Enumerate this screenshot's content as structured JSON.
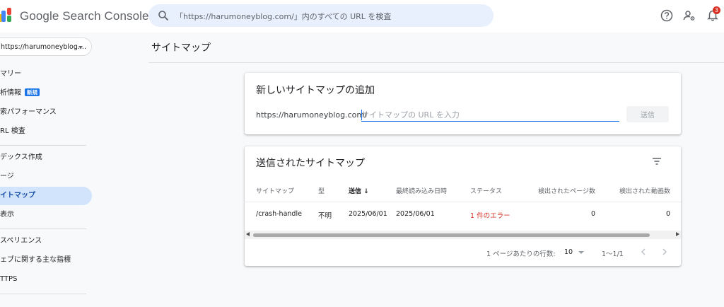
{
  "header": {
    "app_title": "Google Search Console",
    "search_placeholder": "「https://harumoneyblog.com/」内のすべての URL を検査",
    "notification_count": "3",
    "icons": [
      "logo-icon",
      "search-icon",
      "help-icon",
      "manage-users-icon",
      "notifications-icon"
    ]
  },
  "sidebar": {
    "property": "https://harumoneyblog....",
    "items": [
      {
        "label": "マリー"
      },
      {
        "label": "析情報",
        "badge": "新規"
      },
      {
        "label": "索パフォーマンス"
      },
      {
        "label": "RL 検査"
      },
      {
        "label": "デックス作成"
      },
      {
        "label": "ージ"
      },
      {
        "label": "イトマップ",
        "active": true
      },
      {
        "label": "表示"
      },
      {
        "label": "スペリエンス"
      },
      {
        "label": "ェブに関する主な指標"
      },
      {
        "label": "TTPS"
      }
    ]
  },
  "main": {
    "page_title": "サイトマップ",
    "add_card": {
      "title": "新しいサイトマップの追加",
      "url_prefix": "https://harumoneyblog.com/",
      "input_placeholder": "サイトマップの URL を入力",
      "submit_label": "送信"
    },
    "submitted_card": {
      "title": "送信されたサイトマップ",
      "columns": [
        "サイトマップ",
        "型",
        "送信",
        "最終読み込み日時",
        "ステータス",
        "検出されたページ数",
        "検出された動画数"
      ],
      "sorted_column": "送信",
      "rows": [
        {
          "sitemap": "/crash-handle",
          "type": "不明",
          "submitted": "2025/06/01",
          "last_read": "2025/06/01",
          "status": "1 件のエラー",
          "pages": "0",
          "videos": "0"
        }
      ],
      "pagination": {
        "rows_per_page_label": "1 ページあたりの行数:",
        "rows_per_page": "10",
        "range": "1〜1/1"
      }
    }
  },
  "colors": {
    "accent": "#1a73e8",
    "active_nav_bg": "#d2e3fc",
    "error": "#d93025",
    "search_bg": "#e8f0fe"
  }
}
